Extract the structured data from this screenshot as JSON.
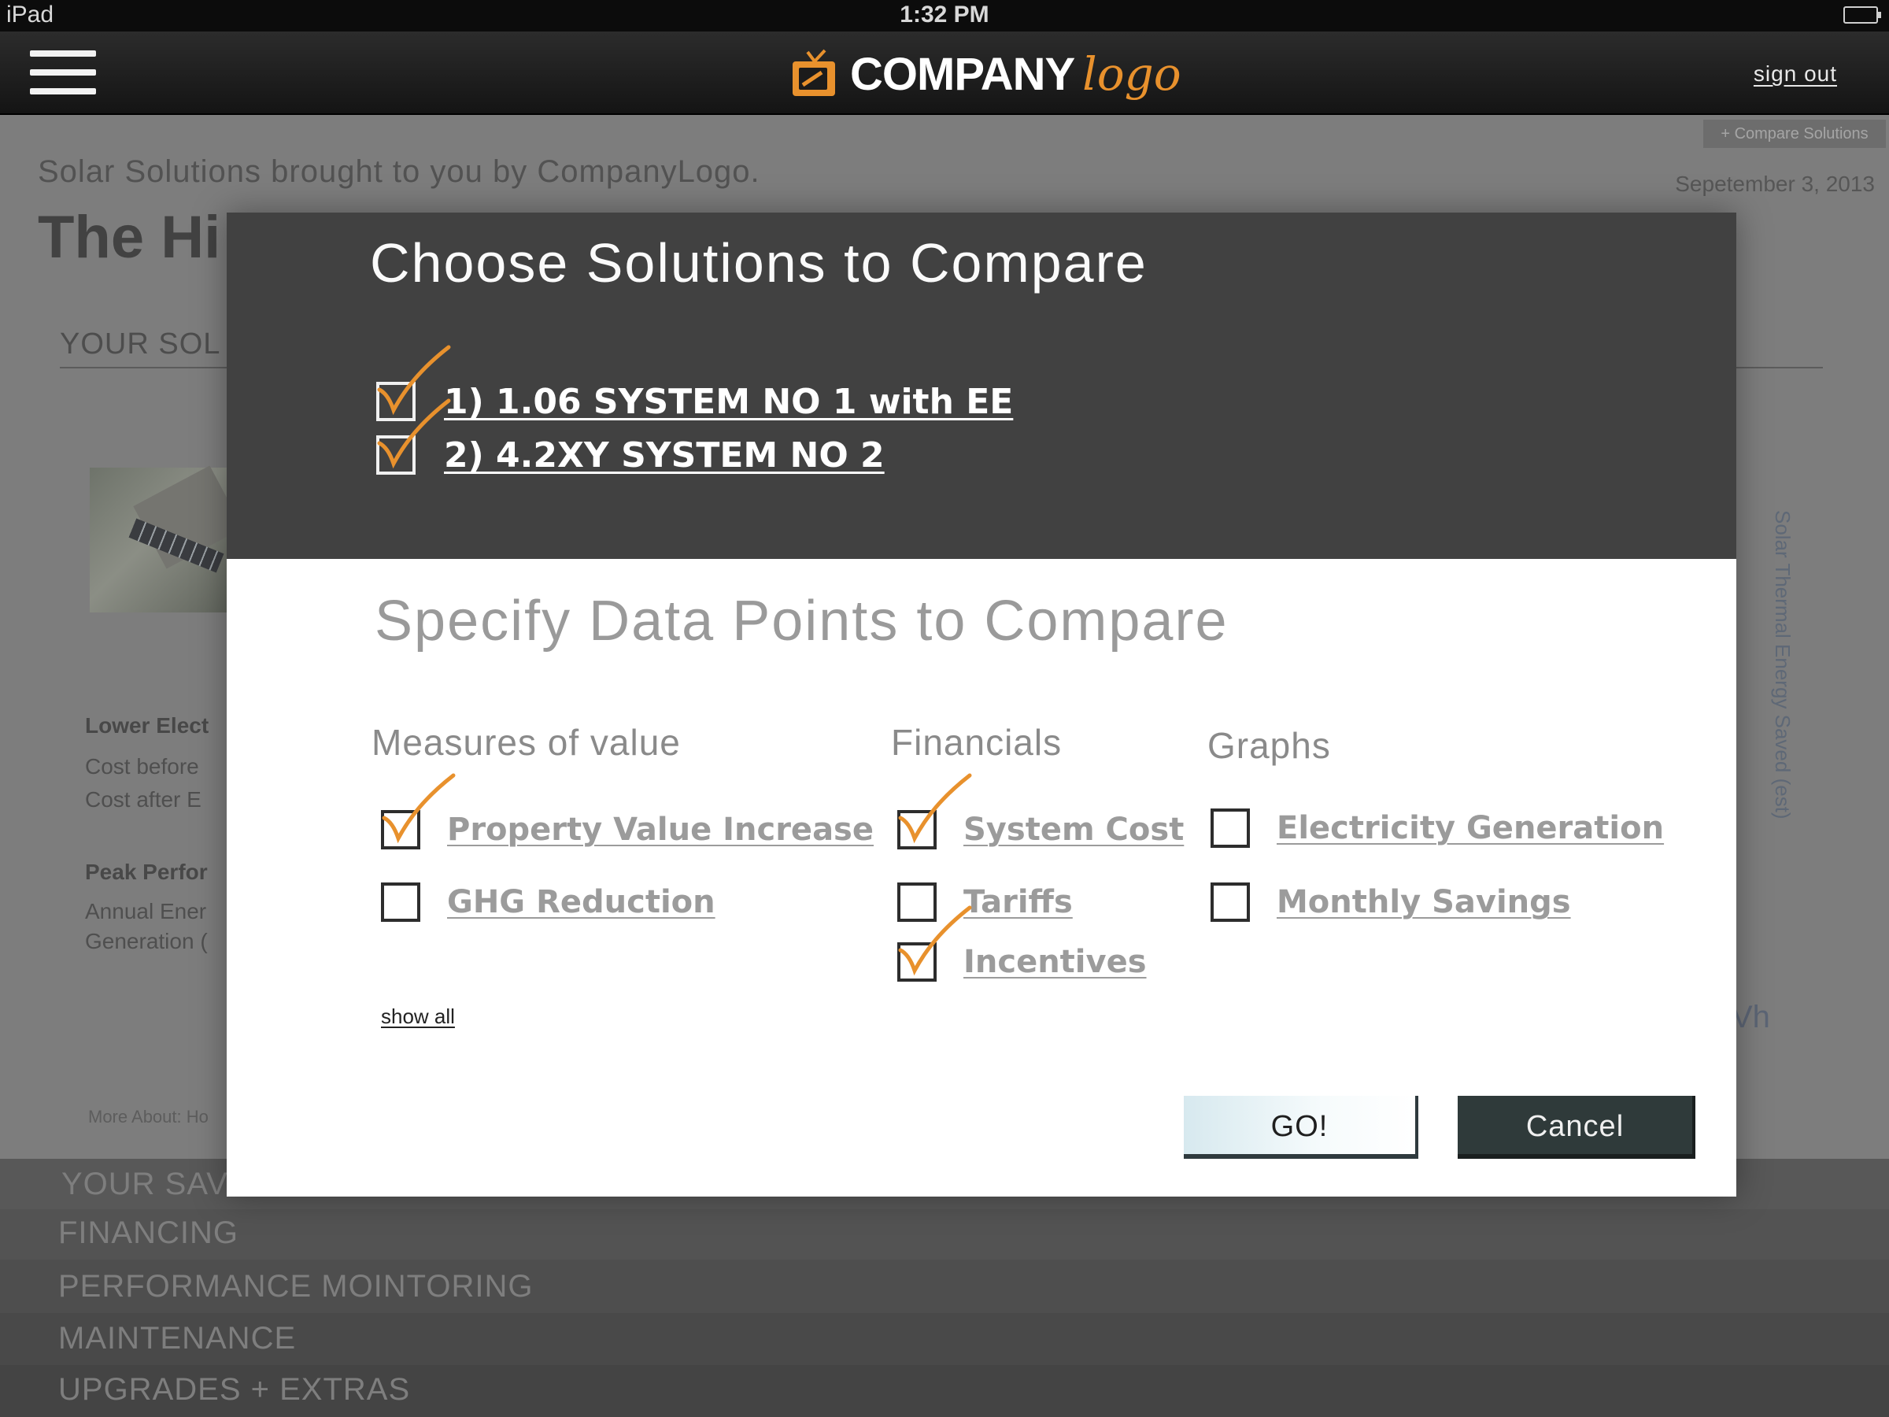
{
  "status_bar": {
    "device": "iPad",
    "time": "1:32 PM"
  },
  "nav": {
    "logo_company": "COMPANY",
    "logo_script": "logo",
    "sign_out": "sign out"
  },
  "background": {
    "compare_chip": "+ Compare Solutions",
    "tagline": "Solar Solutions brought to you by CompanyLogo.",
    "date": "Sepetember 3, 2013",
    "title_fragment": "The Hi",
    "section_fragment": "YOUR SOL",
    "lower_label": "Lower Elect",
    "cost_before": "Cost before",
    "cost_after": "Cost after E",
    "peak_label": "Peak Perfor",
    "annual_line1": "Annual Ener",
    "annual_line2": "Generation (",
    "more_about": "More About: Ho",
    "vertical_label": "Solar Thermal Energy Saved (est)",
    "kwh_fragment": "Vh",
    "bottom_nav": [
      "YOUR SAVINGS",
      "FINANCING",
      "PERFORMANCE MOINTORING",
      "MAINTENANCE",
      "UPGRADES + EXTRAS"
    ]
  },
  "modal": {
    "title": "Choose Solutions to Compare",
    "solutions": [
      {
        "label": "1) 1.06 SYSTEM NO 1 with EE",
        "checked": true
      },
      {
        "label": "2) 4.2XY SYSTEM NO 2",
        "checked": true
      }
    ],
    "subtitle": "Specify Data Points to Compare",
    "columns": [
      {
        "heading": "Measures of value",
        "items": [
          {
            "label": "Property Value Increase",
            "checked": true
          },
          {
            "label": "GHG Reduction",
            "checked": false
          }
        ]
      },
      {
        "heading": "Financials",
        "items": [
          {
            "label": "System Cost",
            "checked": true
          },
          {
            "label": "Tariffs",
            "checked": false
          },
          {
            "label": "Incentives",
            "checked": true
          }
        ]
      },
      {
        "heading": "Graphs",
        "items": [
          {
            "label": "Electricity Generation",
            "checked": false
          },
          {
            "label": "Monthly Savings",
            "checked": false
          }
        ]
      }
    ],
    "show_all": "show all",
    "go_label": "GO!",
    "cancel_label": "Cancel"
  },
  "colors": {
    "accent_orange": "#e8912d",
    "modal_header_bg": "#414141",
    "cancel_bg": "#2f3a3a",
    "go_bg": "#d7e9ef"
  }
}
